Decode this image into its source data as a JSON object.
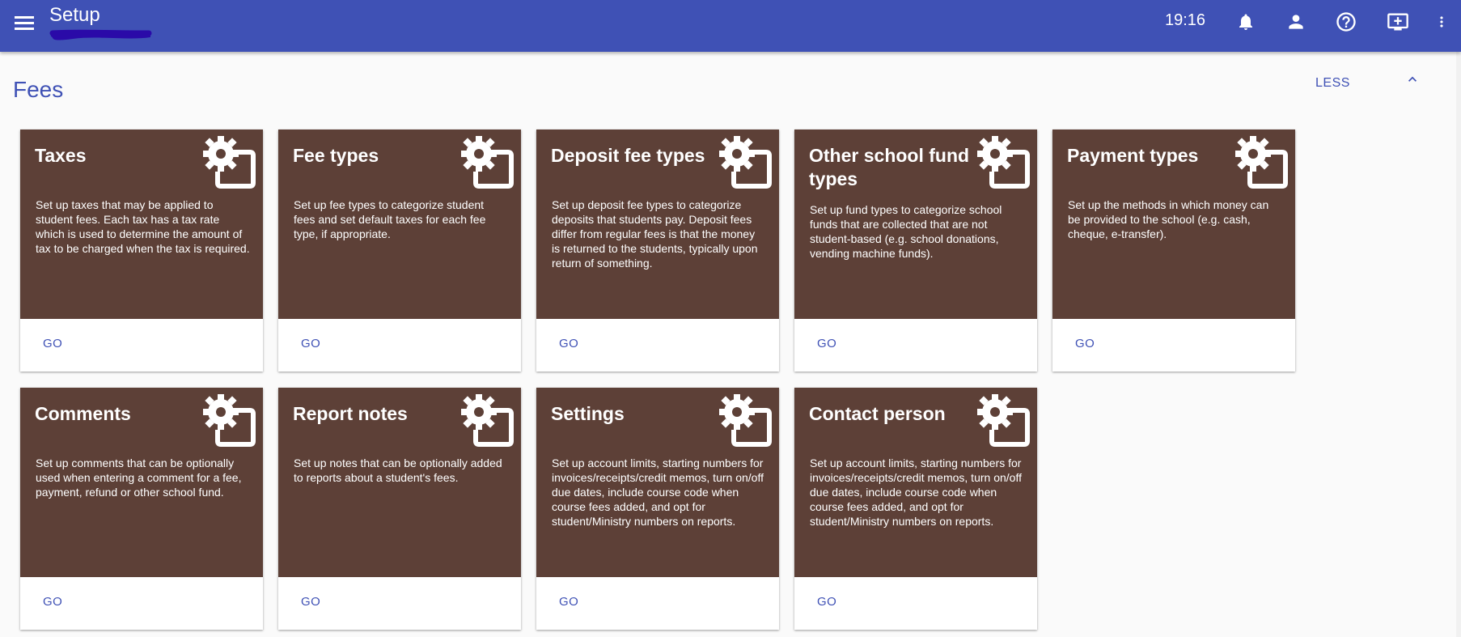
{
  "header": {
    "title": "Setup",
    "time": "19:16",
    "icons": [
      "menu-icon",
      "bell-icon",
      "person-icon",
      "help-icon",
      "monitor-add-icon",
      "more-vert-icon"
    ]
  },
  "section": {
    "title": "Fees",
    "toggle_label": "LESS"
  },
  "colors": {
    "header_bg": "#3f51b5",
    "card_bg": "#5d4037",
    "accent": "#3f51b5"
  },
  "cards": [
    {
      "title": "Taxes",
      "description": "Set up taxes that may be applied to student fees. Each tax has a tax rate which is used to determine the amount of tax to be charged when the tax is required.",
      "action": "GO"
    },
    {
      "title": "Fee types",
      "description": "Set up fee types to categorize student fees and set default taxes for each fee type, if appropriate.",
      "action": "GO"
    },
    {
      "title": "Deposit fee types",
      "description": "Set up deposit fee types to categorize deposits that students pay. Deposit fees differ from regular fees is that the money is returned to the students, typically upon return of something.",
      "action": "GO"
    },
    {
      "title": "Other school fund types",
      "description": "Set up fund types to categorize school funds that are collected that are not student-based (e.g. school donations, vending machine funds).",
      "action": "GO"
    },
    {
      "title": "Payment types",
      "description": "Set up the methods in which money can be provided to the school (e.g. cash, cheque, e-transfer).",
      "action": "GO"
    },
    {
      "title": "Comments",
      "description": "Set up comments that can be optionally used when entering a comment for a fee, payment, refund or other school fund.",
      "action": "GO"
    },
    {
      "title": "Report notes",
      "description": "Set up notes that can be optionally added to reports about a student's fees.",
      "action": "GO"
    },
    {
      "title": "Settings",
      "description": "Set up account limits, starting numbers for invoices/receipts/credit memos, turn on/off due dates, include course code when course fees added, and opt for student/Ministry numbers on reports.",
      "action": "GO"
    },
    {
      "title": "Contact person",
      "description": "Set up account limits, starting numbers for invoices/receipts/credit memos, turn on/off due dates, include course code when course fees added, and opt for student/Ministry numbers on reports.",
      "action": "GO"
    }
  ]
}
